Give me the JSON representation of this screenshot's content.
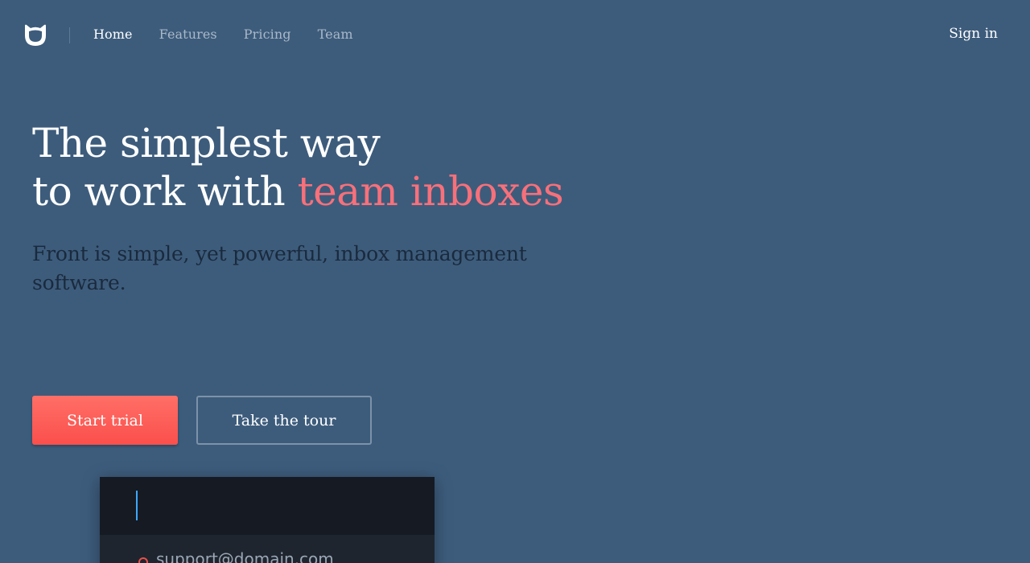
{
  "nav": {
    "logo_icon": "front-logo-icon",
    "links": [
      {
        "label": "Home",
        "active": true
      },
      {
        "label": "Features",
        "active": false
      },
      {
        "label": "Pricing",
        "active": false
      },
      {
        "label": "Team",
        "active": false
      }
    ],
    "signin_label": "Sign in"
  },
  "hero": {
    "title_line1": "The simplest way",
    "title_line2_prefix": "to work with ",
    "title_line2_accent": "team inboxes",
    "subtitle": "Front is simple, yet powerful, inbox management software."
  },
  "cta": {
    "primary_label": "Start trial",
    "secondary_label": "Take the tour"
  },
  "preview": {
    "inbox_email": "support@domain.com"
  },
  "colors": {
    "background": "#3d5c7c",
    "accent": "#f7707a",
    "primary_button": "#fb5a56",
    "cursor": "#3ea7ff"
  }
}
